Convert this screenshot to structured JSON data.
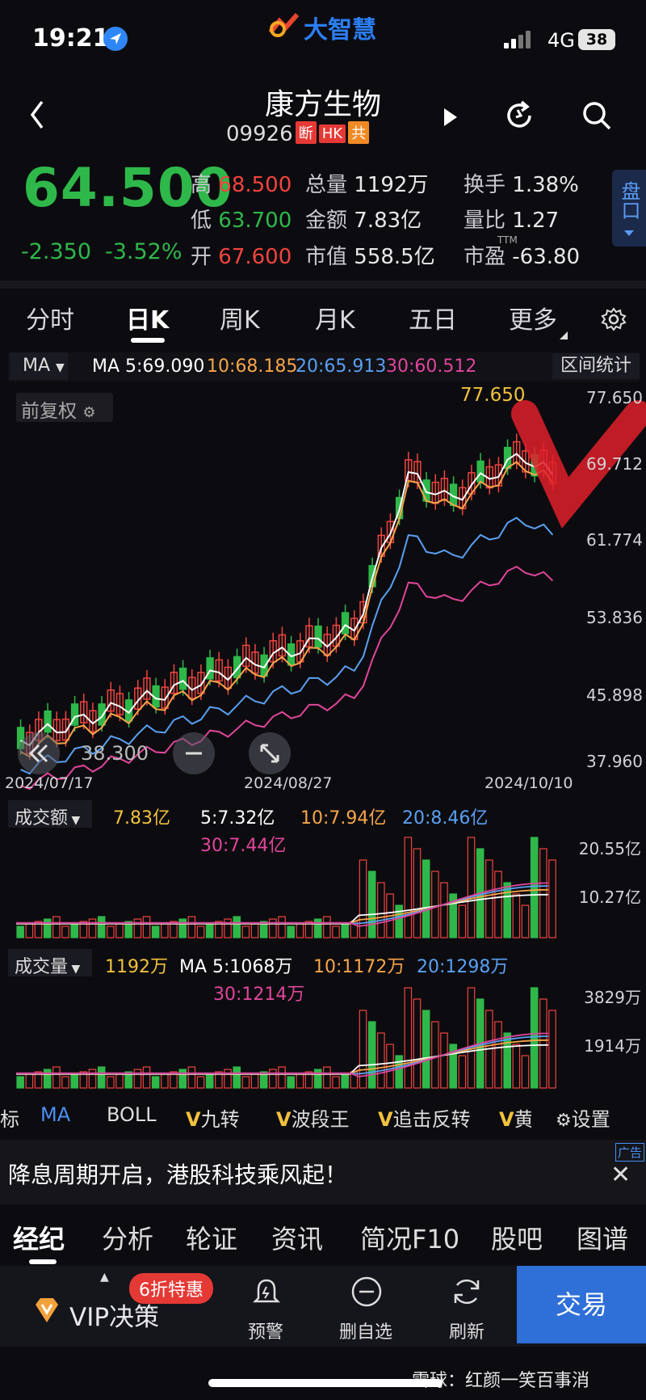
{
  "status": {
    "time": "19:21",
    "network": "4G",
    "battery": "38",
    "app_logo": "大智慧"
  },
  "header": {
    "title": "康方生物",
    "code": "09926",
    "tags": [
      "断",
      "HK",
      "共"
    ]
  },
  "quote": {
    "price": "64.500",
    "change": "-2.350",
    "change_pct": "-3.52%",
    "high_label": "高",
    "high": "68.500",
    "low_label": "低",
    "low": "63.700",
    "open_label": "开",
    "open": "67.600",
    "volume_label": "总量",
    "volume": "1192万",
    "amount_label": "金额",
    "amount": "7.83亿",
    "mcap_label": "市值",
    "mcap": "558.5亿",
    "turnover_label": "换手",
    "turnover": "1.38%",
    "vr_label": "量比",
    "vr": "1.27",
    "pe_label": "市盈",
    "pe_sup": "TTM",
    "pe": "-63.80",
    "pankou": "盘口"
  },
  "tabs": [
    "分时",
    "日K",
    "周K",
    "月K",
    "五日",
    "更多"
  ],
  "active_tab": "日K",
  "ma": {
    "selector": "MA",
    "ma5": "MA 5:69.090",
    "ma10": "10:68.185",
    "ma20": "20:65.913",
    "ma30": "30:60.512",
    "range_button": "区间统计"
  },
  "price_chart": {
    "adjust": "前复权",
    "max_label": "77.650",
    "overlay_value": "38.300",
    "y_ticks": [
      "77.650",
      "69.712",
      "61.774",
      "53.836",
      "45.898",
      "37.960"
    ],
    "x_ticks": [
      "2024/07/17",
      "2024/08/27",
      "2024/10/10"
    ]
  },
  "amount_panel": {
    "label": "成交额",
    "value": "7.83亿",
    "ma5": "5:7.32亿",
    "ma10": "10:7.94亿",
    "ma20": "20:8.46亿",
    "ma30": "30:7.44亿",
    "y_ticks": [
      "20.55亿",
      "10.27亿"
    ]
  },
  "volume_panel": {
    "label": "成交量",
    "value": "1192万",
    "ma5": "MA 5:1068万",
    "ma10": "10:1172万",
    "ma20": "20:1298万",
    "ma30": "30:1214万",
    "y_ticks": [
      "3829万",
      "1914万"
    ]
  },
  "indicators": [
    "标",
    "MA",
    "BOLL",
    "九转",
    "波段王",
    "追击反转",
    "黄",
    "设置"
  ],
  "ad": {
    "text": "降息周期开启，港股科技乘风起！",
    "label": "广告"
  },
  "bottom_tabs": [
    "经纪",
    "分析",
    "轮证",
    "资讯",
    "简况F10",
    "股吧",
    "图谱"
  ],
  "toolbar": {
    "vip": "VIP决策",
    "badge": "6折特惠",
    "alert": "预警",
    "remove": "删自选",
    "refresh": "刷新",
    "trade": "交易"
  },
  "watermark": "雪球：红颜一笑百事消",
  "colors": {
    "up": "#f0443e",
    "down": "#2fb84a",
    "ma5": "#ffffff",
    "ma10": "#f7a54a",
    "ma20": "#5aa0f2",
    "ma30": "#e0459b"
  }
}
